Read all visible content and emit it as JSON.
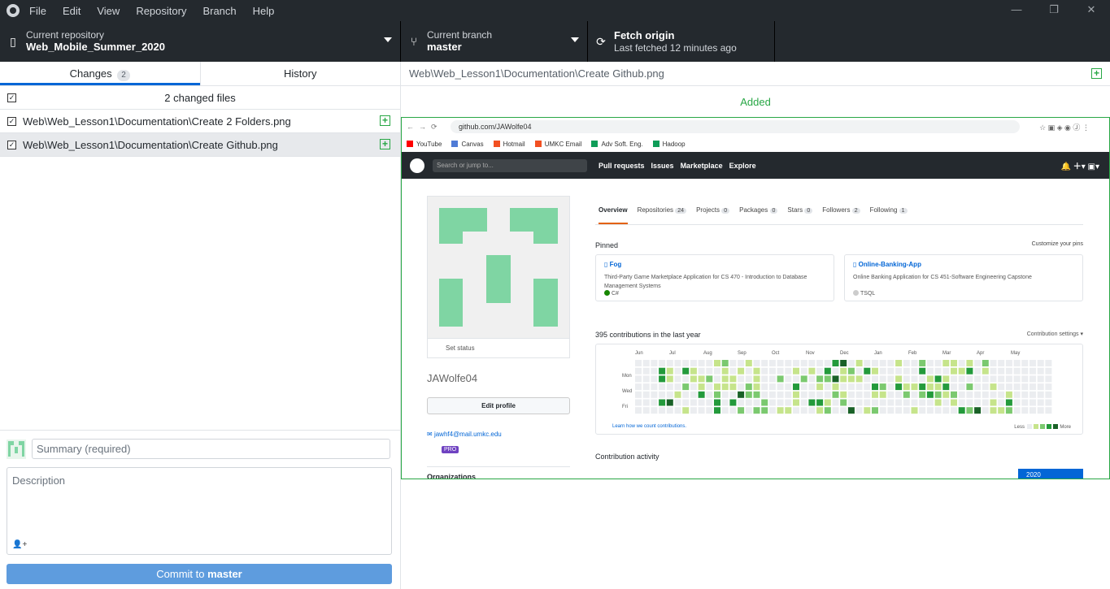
{
  "menu": [
    "File",
    "Edit",
    "View",
    "Repository",
    "Branch",
    "Help"
  ],
  "window_controls": {
    "minimize": "—",
    "maximize": "❐",
    "close": "✕"
  },
  "toolbar": {
    "repo_label": "Current repository",
    "repo_name": "Web_Mobile_Summer_2020",
    "branch_label": "Current branch",
    "branch_name": "master",
    "fetch_label": "Fetch origin",
    "fetch_status": "Last fetched 12 minutes ago"
  },
  "tabs": {
    "changes_label": "Changes",
    "changes_count": "2",
    "history_label": "History"
  },
  "changes": {
    "summary": "2 changed files",
    "files": [
      "Web\\Web_Lesson1\\Documentation\\Create 2 Folders.png",
      "Web\\Web_Lesson1\\Documentation\\Create Github.png"
    ]
  },
  "commit": {
    "summary_placeholder": "Summary (required)",
    "description_placeholder": "Description",
    "button_prefix": "Commit to ",
    "button_branch": "master"
  },
  "diff": {
    "path": "Web\\Web_Lesson1\\Documentation\\Create Github.png",
    "status": "Added"
  },
  "screenshot": {
    "url": "github.com/JAWolfe04",
    "bookmarks": [
      "YouTube",
      "Canvas",
      "Hotmail",
      "UMKC Email",
      "Adv Soft. Eng.",
      "Hadoop"
    ],
    "gh_search": "Search or jump to...",
    "gh_nav": [
      "Pull requests",
      "Issues",
      "Marketplace",
      "Explore"
    ],
    "set_status": "Set status",
    "username": "JAWolfe04",
    "edit_profile": "Edit profile",
    "email": "jawhf4@mail.umkc.edu",
    "pro": "PRO",
    "organizations": "Organizations",
    "profile_tabs": [
      {
        "label": "Overview",
        "count": ""
      },
      {
        "label": "Repositories",
        "count": "24"
      },
      {
        "label": "Projects",
        "count": "0"
      },
      {
        "label": "Packages",
        "count": "0"
      },
      {
        "label": "Stars",
        "count": "0"
      },
      {
        "label": "Followers",
        "count": "2"
      },
      {
        "label": "Following",
        "count": "1"
      }
    ],
    "pinned": "Pinned",
    "customize": "Customize your pins",
    "repos": [
      {
        "name": "Fog",
        "desc": "Third-Party Game Marketplace Application for CS 470 - Introduction to Database Management Systems",
        "lang": "C#",
        "color": "#178600"
      },
      {
        "name": "Online-Banking-App",
        "desc": "Online Banking Application for CS 451-Software Engineering Capstone",
        "lang": "TSQL",
        "color": "#cccccc"
      }
    ],
    "contributions": "395 contributions in the last year",
    "contrib_settings": "Contribution settings ▾",
    "months": [
      "Jun",
      "Jul",
      "Aug",
      "Sep",
      "Oct",
      "Nov",
      "Dec",
      "Jan",
      "Feb",
      "Mar",
      "Apr",
      "May"
    ],
    "days": [
      "Mon",
      "Wed",
      "Fri"
    ],
    "learn": "Learn how we count contributions.",
    "less": "Less",
    "more": "More",
    "activity": "Contribution activity",
    "year": "2020"
  }
}
